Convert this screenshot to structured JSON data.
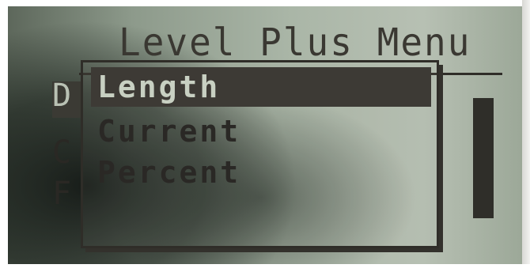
{
  "screen": {
    "title": "Level Plus Menu"
  },
  "background_menu": {
    "items": [
      {
        "letter": "D",
        "selected": true
      },
      {
        "letter": "C",
        "selected": false
      },
      {
        "letter": "F",
        "selected": false
      }
    ]
  },
  "popup": {
    "options": [
      {
        "label": "Length",
        "selected": true
      },
      {
        "label": "Current",
        "selected": false
      },
      {
        "label": "Percent",
        "selected": false
      }
    ]
  },
  "colors": {
    "lcd_background": "#aab6a7",
    "lcd_pixel": "#2c2a26",
    "selection_background": "#3d3a35",
    "selection_text": "#c8d0c2"
  }
}
